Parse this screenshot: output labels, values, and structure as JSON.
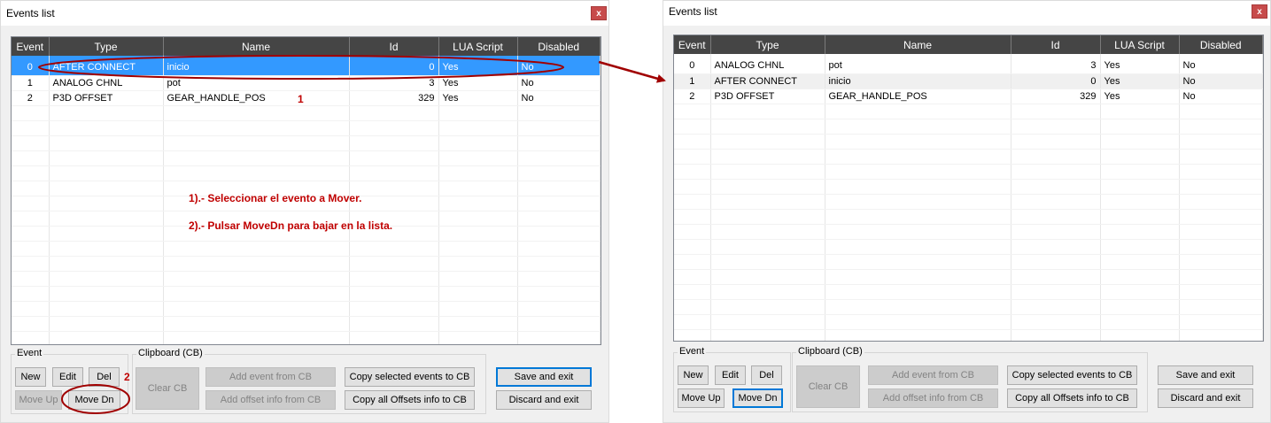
{
  "left": {
    "title": "Events list",
    "close_label": "x",
    "columns": [
      "Event",
      "Type",
      "Name",
      "Id",
      "LUA Script",
      "Disabled"
    ],
    "rows": [
      {
        "event": "0",
        "type": "AFTER CONNECT",
        "name": "inicio",
        "id": "0",
        "lua": "Yes",
        "disabled": "No"
      },
      {
        "event": "1",
        "type": "ANALOG CHNL",
        "name": "pot",
        "id": "3",
        "lua": "Yes",
        "disabled": "No"
      },
      {
        "event": "2",
        "type": "P3D OFFSET",
        "name": "GEAR_HANDLE_POS",
        "id": "329",
        "lua": "Yes",
        "disabled": "No"
      }
    ],
    "annotations": {
      "step1_number": "1",
      "step2_number": "2",
      "line1": "1).- Seleccionar el evento a Mover.",
      "line2": "2).- Pulsar MoveDn para bajar en la lista."
    }
  },
  "right": {
    "title": "Events list",
    "close_label": "x",
    "columns": [
      "Event",
      "Type",
      "Name",
      "Id",
      "LUA Script",
      "Disabled"
    ],
    "rows": [
      {
        "event": "0",
        "type": "ANALOG CHNL",
        "name": "pot",
        "id": "3",
        "lua": "Yes",
        "disabled": "No"
      },
      {
        "event": "1",
        "type": "AFTER CONNECT",
        "name": "inicio",
        "id": "0",
        "lua": "Yes",
        "disabled": "No"
      },
      {
        "event": "2",
        "type": "P3D OFFSET",
        "name": "GEAR_HANDLE_POS",
        "id": "329",
        "lua": "Yes",
        "disabled": "No"
      }
    ]
  },
  "controls": {
    "event_group_label": "Event",
    "clipboard_group_label": "Clipboard (CB)",
    "new": "New",
    "edit": "Edit",
    "del": "Del",
    "move_up": "Move Up",
    "move_dn": "Move Dn",
    "clear_cb": "Clear CB",
    "add_event_from_cb": "Add event from CB",
    "add_offset_info_from_cb": "Add offset info from CB",
    "copy_selected_events": "Copy selected events to CB",
    "copy_all_offsets": "Copy all Offsets info to CB",
    "save_and_exit": "Save and exit",
    "discard_and_exit": "Discard and exit"
  },
  "colors": {
    "selection": "#3399ff",
    "header": "#454545",
    "annotation": "#c00000",
    "focus": "#0078d7"
  }
}
